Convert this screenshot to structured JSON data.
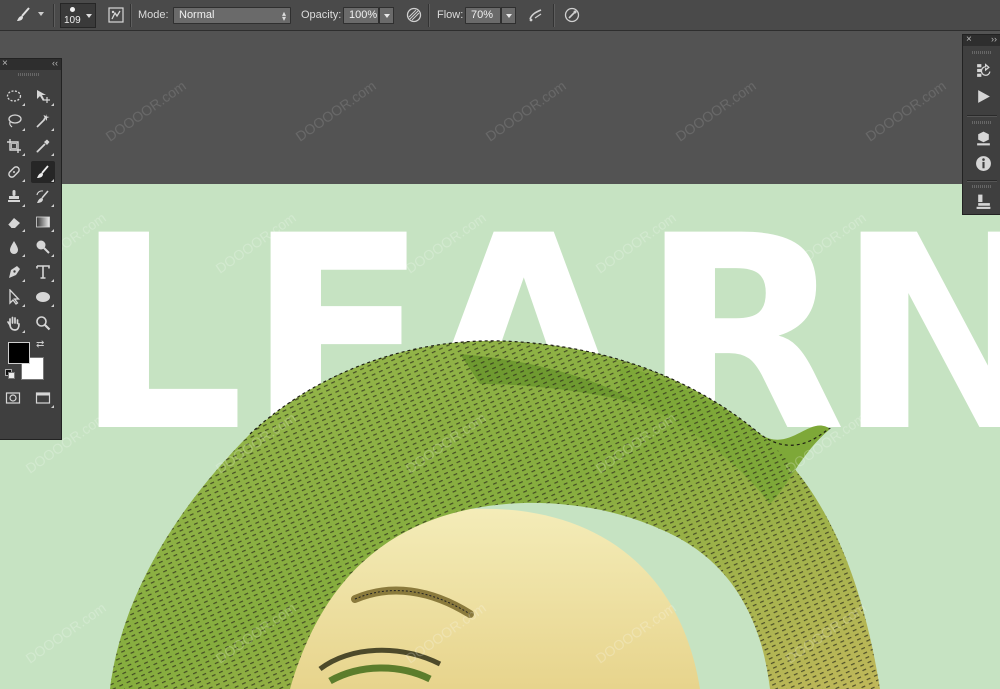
{
  "options_bar": {
    "tool": "brush-tool",
    "brush_size": "109",
    "mode_label": "Mode:",
    "mode_value": "Normal",
    "opacity_label": "Opacity:",
    "opacity_value": "100%",
    "flow_label": "Flow:",
    "flow_value": "70%"
  },
  "canvas": {
    "headline": [
      "L",
      "E",
      "A",
      "R",
      "N"
    ],
    "background_color": "#c6e3c2",
    "headline_color": "#ffffff",
    "watermark": "DOOOOR.com"
  },
  "tools_panel": {
    "tools": [
      "elliptical-marquee-icon",
      "move-icon",
      "lasso-icon",
      "magic-wand-icon",
      "crop-icon",
      "eyedropper-icon",
      "spot-healing-icon",
      "brush-icon",
      "clone-stamp-icon",
      "history-brush-icon",
      "eraser-icon",
      "gradient-icon",
      "blur-icon",
      "dodge-icon",
      "pen-icon",
      "type-icon",
      "path-selection-icon",
      "ellipse-shape-icon",
      "hand-icon",
      "zoom-icon"
    ],
    "active_tool": "brush-icon",
    "foreground_color": "#000000",
    "background_color": "#ffffff"
  },
  "right_panel": {
    "icons": [
      "history-icon",
      "actions-play-icon",
      "properties-icon",
      "info-icon",
      "layer-comps-icon"
    ]
  }
}
